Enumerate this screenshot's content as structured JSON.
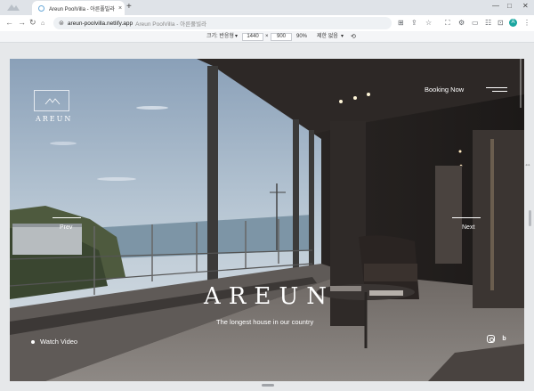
{
  "browser": {
    "tab": {
      "title": "Areun PoolVilla - 아른풀빌라",
      "close_icon": "×"
    },
    "new_tab_label": "+",
    "address": {
      "url": "areun-poolvilla.netlify.app",
      "page_title": "Areun PoolVilla - 아른풀빌라"
    },
    "window_controls": {
      "minimize": "—",
      "maximize": "□",
      "close": "✕"
    },
    "profile_initial": "A"
  },
  "device_toolbar": {
    "dimensions_label": "크기: 반응형",
    "width": "1440",
    "times": "×",
    "height": "900",
    "zoom": "90%",
    "throttle": "제한 없음"
  },
  "site": {
    "logo_text": "AREUN",
    "booking_label": "Booking Now",
    "prev_label": "Prev",
    "next_label": "Next",
    "hero_title": "AREUN",
    "tagline": "The longest house in our country",
    "watch_video_label": "Watch Video",
    "blog_label": "b"
  }
}
